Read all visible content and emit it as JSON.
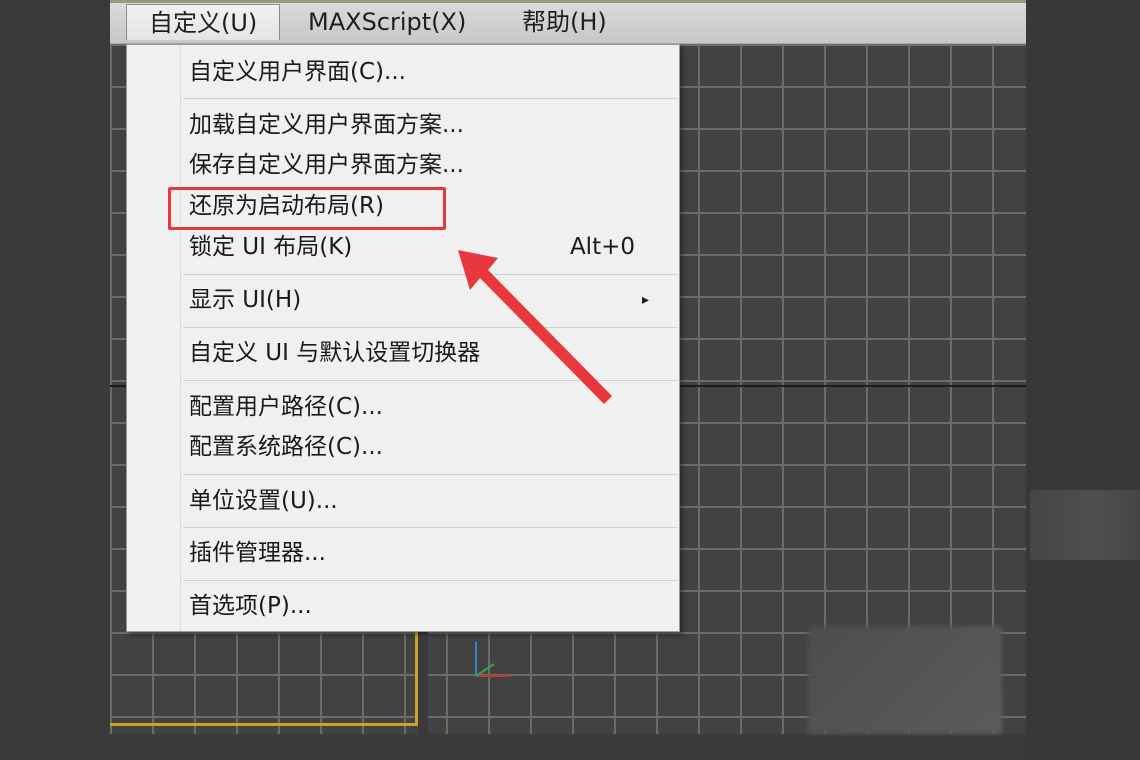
{
  "menubar": {
    "items": [
      {
        "label": "自定义(U)",
        "active": true
      },
      {
        "label": "MAXScript(X)",
        "active": false
      },
      {
        "label": "帮助(H)",
        "active": false
      }
    ]
  },
  "dropdown": {
    "items": [
      {
        "label": "自定义用户界面(C)..."
      },
      {
        "label": "加载自定义用户界面方案..."
      },
      {
        "label": "保存自定义用户界面方案..."
      },
      {
        "label": "还原为启动布局(R)"
      },
      {
        "label": "锁定 UI 布局(K)",
        "shortcut": "Alt+0"
      },
      {
        "label": "显示 UI(H)",
        "submenu_arrow": "▸"
      },
      {
        "label": "自定义 UI 与默认设置切换器"
      },
      {
        "label": "配置用户路径(C)..."
      },
      {
        "label": "配置系统路径(C)..."
      },
      {
        "label": "单位设置(U)..."
      },
      {
        "label": "插件管理器..."
      },
      {
        "label": "首选项(P)..."
      }
    ]
  },
  "annotation": {
    "highlight_color": "#e8383d",
    "highlighted_item": "还原为启动布局(R)"
  },
  "colors": {
    "menu_background": "#f0f0f0",
    "viewport_background": "#424242",
    "grid_line": "#6c6c6c",
    "active_viewport_border": "#c9a227"
  }
}
